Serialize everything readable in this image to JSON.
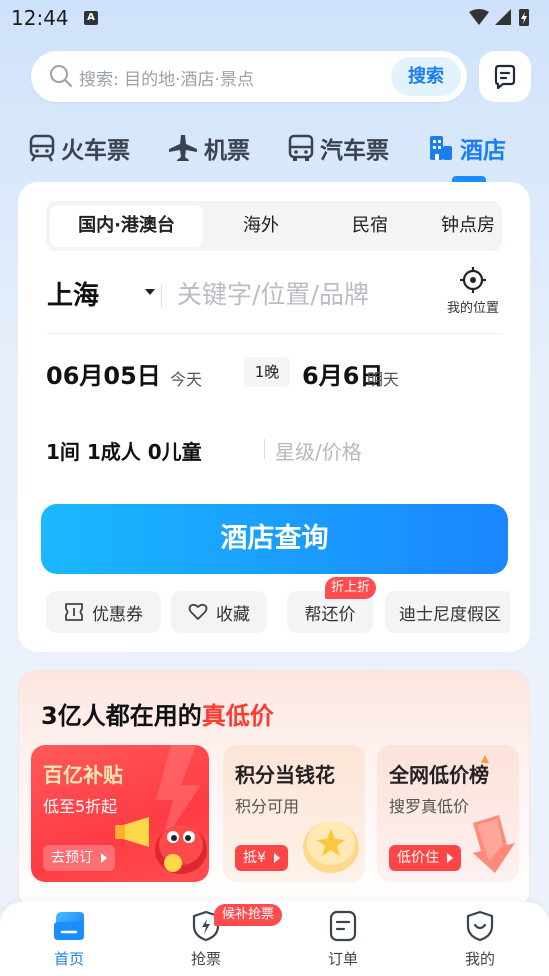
{
  "status_bar": {
    "time": "12:44",
    "notif_letter": "A"
  },
  "search": {
    "placeholder": "搜索: 目的地·酒店·景点",
    "button": "搜索"
  },
  "top_tabs": [
    {
      "label": "火车票",
      "icon": "train-icon"
    },
    {
      "label": "机票",
      "icon": "plane-icon"
    },
    {
      "label": "汽车票",
      "icon": "bus-icon"
    },
    {
      "label": "酒店",
      "icon": "hotel-icon",
      "active": true
    }
  ],
  "sub_tabs": [
    "国内·港澳台",
    "海外",
    "民宿",
    "钟点房"
  ],
  "booking": {
    "city": "上海",
    "keyword_placeholder": "关键字/位置/品牌",
    "location_label": "我的位置",
    "checkin_date": "06月05日",
    "checkin_note": "今天",
    "nights": "1晚",
    "checkout_date": "6月6日",
    "checkout_note": "明天",
    "guests": "1间 1成人 0儿童",
    "star_price_placeholder": "星级/价格",
    "query_button": "酒店查询"
  },
  "chips": [
    {
      "label": "优惠券",
      "icon": "coupon-icon"
    },
    {
      "label": "收藏",
      "icon": "heart-icon"
    },
    {
      "label": "帮还价",
      "badge": "折上折"
    },
    {
      "label": "迪士尼度假区"
    }
  ],
  "promo": {
    "title_prefix": "3亿人都在用的",
    "title_highlight": "真低价",
    "items": [
      {
        "title": "百亿补贴",
        "sub": "低至5折起",
        "button": "去预订"
      },
      {
        "title": "积分当钱花",
        "sub": "积分可用",
        "button": "抵¥"
      },
      {
        "title": "全网低价榜",
        "sub": "搜罗真低价",
        "button": "低价住"
      }
    ]
  },
  "bottom_nav": [
    {
      "label": "首页",
      "icon": "home-icon",
      "active": true
    },
    {
      "label": "抢票",
      "icon": "ticket-grab-icon",
      "badge": "候补抢票"
    },
    {
      "label": "订单",
      "icon": "order-icon"
    },
    {
      "label": "我的",
      "icon": "profile-icon"
    }
  ],
  "colors": {
    "accent": "#1a7ff0",
    "promo_red": "#ff3b30"
  }
}
